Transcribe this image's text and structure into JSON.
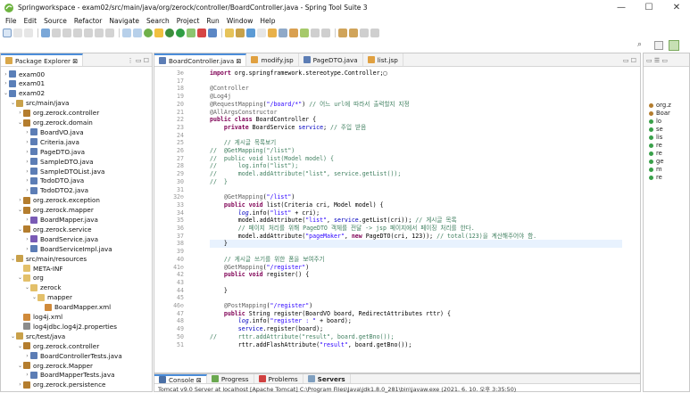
{
  "window": {
    "title": "Springworkspace - exam02/src/main/java/org/zerock/controller/BoardController.java - Spring Tool Suite 3",
    "minimize": "—",
    "maximize": "☐",
    "close": "✕"
  },
  "menu": [
    "File",
    "Edit",
    "Source",
    "Refactor",
    "Navigate",
    "Search",
    "Project",
    "Run",
    "Window",
    "Help"
  ],
  "explorer": {
    "tab_label": "Package Explorer ⊠",
    "items": [
      {
        "label": "exam00",
        "depth": 0,
        "twisty": "›",
        "icon": "project-icon",
        "color": "#5a7fb8"
      },
      {
        "label": "exam01",
        "depth": 0,
        "twisty": "›",
        "icon": "project-icon",
        "color": "#5a7fb8"
      },
      {
        "label": "exam02",
        "depth": 0,
        "twisty": "⌄",
        "icon": "project-icon",
        "color": "#5a7fb8"
      },
      {
        "label": "src/main/java",
        "depth": 1,
        "twisty": "⌄",
        "icon": "source-folder-icon",
        "color": "#c9a14a"
      },
      {
        "label": "org.zerock.controller",
        "depth": 2,
        "twisty": "›",
        "icon": "package-icon",
        "color": "#b47d2e"
      },
      {
        "label": "org.zerock.domain",
        "depth": 2,
        "twisty": "⌄",
        "icon": "package-icon",
        "color": "#b47d2e"
      },
      {
        "label": "BoardVO.java",
        "depth": 3,
        "twisty": "›",
        "icon": "java-file-icon",
        "color": "#5c7db5"
      },
      {
        "label": "Criteria.java",
        "depth": 3,
        "twisty": "›",
        "icon": "java-file-icon",
        "color": "#5c7db5"
      },
      {
        "label": "PageDTO.java",
        "depth": 3,
        "twisty": "›",
        "icon": "java-file-icon",
        "color": "#5c7db5"
      },
      {
        "label": "SampleDTO.java",
        "depth": 3,
        "twisty": "›",
        "icon": "java-file-icon",
        "color": "#5c7db5"
      },
      {
        "label": "SampleDTOList.java",
        "depth": 3,
        "twisty": "›",
        "icon": "java-file-icon",
        "color": "#5c7db5"
      },
      {
        "label": "TodoDTO.java",
        "depth": 3,
        "twisty": "›",
        "icon": "java-file-icon",
        "color": "#5c7db5"
      },
      {
        "label": "TodoDTO2.java",
        "depth": 3,
        "twisty": "›",
        "icon": "java-file-icon",
        "color": "#5c7db5"
      },
      {
        "label": "org.zerock.exception",
        "depth": 2,
        "twisty": "›",
        "icon": "package-icon",
        "color": "#b47d2e"
      },
      {
        "label": "org.zerock.mapper",
        "depth": 2,
        "twisty": "⌄",
        "icon": "package-icon",
        "color": "#b47d2e"
      },
      {
        "label": "BoardMapper.java",
        "depth": 3,
        "twisty": "›",
        "icon": "java-interface-icon",
        "color": "#7a5bb5"
      },
      {
        "label": "org.zerock.service",
        "depth": 2,
        "twisty": "⌄",
        "icon": "package-icon",
        "color": "#b47d2e"
      },
      {
        "label": "BoardService.java",
        "depth": 3,
        "twisty": "›",
        "icon": "java-interface-icon",
        "color": "#7a5bb5"
      },
      {
        "label": "BoardServiceImpl.java",
        "depth": 3,
        "twisty": "›",
        "icon": "java-file-icon",
        "color": "#5c7db5"
      },
      {
        "label": "src/main/resources",
        "depth": 1,
        "twisty": "⌄",
        "icon": "source-folder-icon",
        "color": "#c9a14a"
      },
      {
        "label": "META-INF",
        "depth": 2,
        "twisty": "",
        "icon": "folder-icon",
        "color": "#e3c06a"
      },
      {
        "label": "org",
        "depth": 2,
        "twisty": "⌄",
        "icon": "folder-icon",
        "color": "#e3c06a"
      },
      {
        "label": "zerock",
        "depth": 3,
        "twisty": "⌄",
        "icon": "folder-icon",
        "color": "#e3c06a"
      },
      {
        "label": "mapper",
        "depth": 4,
        "twisty": "⌄",
        "icon": "folder-icon",
        "color": "#e3c06a"
      },
      {
        "label": "BoardMapper.xml",
        "depth": 5,
        "twisty": "",
        "icon": "xml-file-icon",
        "color": "#d08a3a"
      },
      {
        "label": "log4j.xml",
        "depth": 2,
        "twisty": "",
        "icon": "xml-file-icon",
        "color": "#d08a3a"
      },
      {
        "label": "log4jdbc.log4j2.properties",
        "depth": 2,
        "twisty": "",
        "icon": "properties-file-icon",
        "color": "#8c8c8c"
      },
      {
        "label": "src/test/java",
        "depth": 1,
        "twisty": "⌄",
        "icon": "source-folder-icon",
        "color": "#c9a14a"
      },
      {
        "label": "org.zerock.controller",
        "depth": 2,
        "twisty": "⌄",
        "icon": "package-icon",
        "color": "#b47d2e"
      },
      {
        "label": "BoardControllerTests.java",
        "depth": 3,
        "twisty": "›",
        "icon": "java-file-icon",
        "color": "#5c7db5"
      },
      {
        "label": "org.zerock.Mapper",
        "depth": 2,
        "twisty": "⌄",
        "icon": "package-icon",
        "color": "#b47d2e"
      },
      {
        "label": "BoardMapperTests.java",
        "depth": 3,
        "twisty": "›",
        "icon": "java-file-icon",
        "color": "#5c7db5"
      },
      {
        "label": "org.zerock.persistence",
        "depth": 2,
        "twisty": "›",
        "icon": "package-icon",
        "color": "#b47d2e"
      },
      {
        "label": "org.zerock.service",
        "depth": 2,
        "twisty": "›",
        "icon": "package-icon",
        "color": "#b47d2e"
      }
    ]
  },
  "editor": {
    "tabs": [
      {
        "label": "BoardController.java ⊠",
        "active": true
      },
      {
        "label": "modify.jsp",
        "active": false
      },
      {
        "label": "PageDTO.java",
        "active": false
      },
      {
        "label": "list.jsp",
        "active": false
      }
    ],
    "lines": [
      {
        "n": "3⊕",
        "html": "<span class='kw'>import</span> org.springframework.stereotype.Controller;▢"
      },
      {
        "n": "17",
        "html": ""
      },
      {
        "n": "18",
        "html": "<span class='an'>@Controller</span>"
      },
      {
        "n": "19",
        "html": "<span class='an'>@Log4j</span>"
      },
      {
        "n": "20",
        "html": "<span class='an'>@RequestMapping</span>(<span class='st'>\"/board/*\"</span>) <span class='cm'>// 어느 url에 따라서 출력할지 지정</span>"
      },
      {
        "n": "21",
        "html": "<span class='an'>@AllArgsConstructor</span>"
      },
      {
        "n": "22",
        "html": "<span class='kw'>public class</span> BoardController {"
      },
      {
        "n": "23",
        "html": "    <span class='kw'>private</span> BoardService <span class='fld'>service</span>; <span class='cm'>// 주입 받음</span>"
      },
      {
        "n": "24",
        "html": ""
      },
      {
        "n": "25",
        "html": "    <span class='cm'>// 게시글 목록보기</span>"
      },
      {
        "n": "26",
        "html": "<span class='cm'>//  @GetMapping(\"/list\")</span>"
      },
      {
        "n": "27",
        "html": "<span class='cm'>//  public void list(Model model) {</span>"
      },
      {
        "n": "28",
        "html": "<span class='cm'>//      log.info(\"list\");</span>"
      },
      {
        "n": "29",
        "html": "<span class='cm'>//      model.addAttribute(\"list\", service.getList());</span>"
      },
      {
        "n": "30",
        "html": "<span class='cm'>//  }</span>"
      },
      {
        "n": "31",
        "html": ""
      },
      {
        "n": "32⊖",
        "html": "    <span class='an'>@GetMapping</span>(<span class='st'>\"/list\"</span>)"
      },
      {
        "n": "33",
        "html": "    <span class='kw'>public void</span> list(Criteria cri, Model model) {"
      },
      {
        "n": "34",
        "html": "        <span class='fld it'>log</span>.info(<span class='st'>\"list\"</span> + cri);"
      },
      {
        "n": "35",
        "html": "        model.addAttribute(<span class='st'>\"list\"</span>, <span class='fld'>service</span>.getList(cri)); <span class='cm'>// 게시글 목록</span>"
      },
      {
        "n": "36",
        "html": "        <span class='cm'>// 페이지 처리를 위해 PageDTO 객체를 전달 -> jsp 페이지에서 페이징 처리를 한다.</span>"
      },
      {
        "n": "37",
        "html": "        model.addAttribute(<span class='st'>\"pageMaker\"</span>, <span class='kw'>new</span> PageDTO(cri, 123)); <span class='cm'>// total(123)을 계산해주어야 함.</span>"
      },
      {
        "n": "38",
        "html": "    }"
      },
      {
        "n": "39",
        "html": ""
      },
      {
        "n": "40",
        "html": "    <span class='cm'>// 게시글 쓰기를 위한 폼을 보여주기</span>"
      },
      {
        "n": "41⊖",
        "html": "    <span class='an'>@GetMapping</span>(<span class='st'>\"/register\"</span>)"
      },
      {
        "n": "42",
        "html": "    <span class='kw'>public void</span> register() {"
      },
      {
        "n": "43",
        "html": ""
      },
      {
        "n": "44",
        "html": "    }"
      },
      {
        "n": "45",
        "html": ""
      },
      {
        "n": "46⊖",
        "html": "    <span class='an'>@PostMapping</span>(<span class='st'>\"/register\"</span>)"
      },
      {
        "n": "47",
        "html": "    <span class='kw'>public</span> String register(BoardVO board, RedirectAttributes rttr) {"
      },
      {
        "n": "48",
        "html": "        <span class='fld it'>log</span>.info(<span class='st'>\"register : \"</span> + board);"
      },
      {
        "n": "49",
        "html": "        <span class='fld'>service</span>.register(board);"
      },
      {
        "n": "50",
        "html": "<span class='cm'>//      rttr.addAttribute(\"result\", board.getBno());</span>"
      },
      {
        "n": "51",
        "html": "        rttr.addFlashAttribute(<span class='st'>\"result\"</span>, board.getBno());"
      }
    ]
  },
  "console": {
    "tabs": [
      "Console ⊠",
      "Progress",
      "Problems",
      "Servers"
    ],
    "status": "Tomcat v9.0 Server at localhost [Apache Tomcat] C:\\Program Files\\Java\\jdk1.8.0_281\\bin\\javaw.exe  (2021. 6. 10. 오후 3:35:50)"
  },
  "outline": {
    "items": [
      "org.z",
      "Boar",
      "lo",
      "se",
      "lis",
      "re",
      "re",
      "ge",
      "m",
      "re"
    ]
  },
  "colors": {
    "accent": "#4b8dd9",
    "keyword": "#7f0055",
    "comment": "#3f7f5f",
    "string": "#2a00ff",
    "field": "#0000c0"
  }
}
